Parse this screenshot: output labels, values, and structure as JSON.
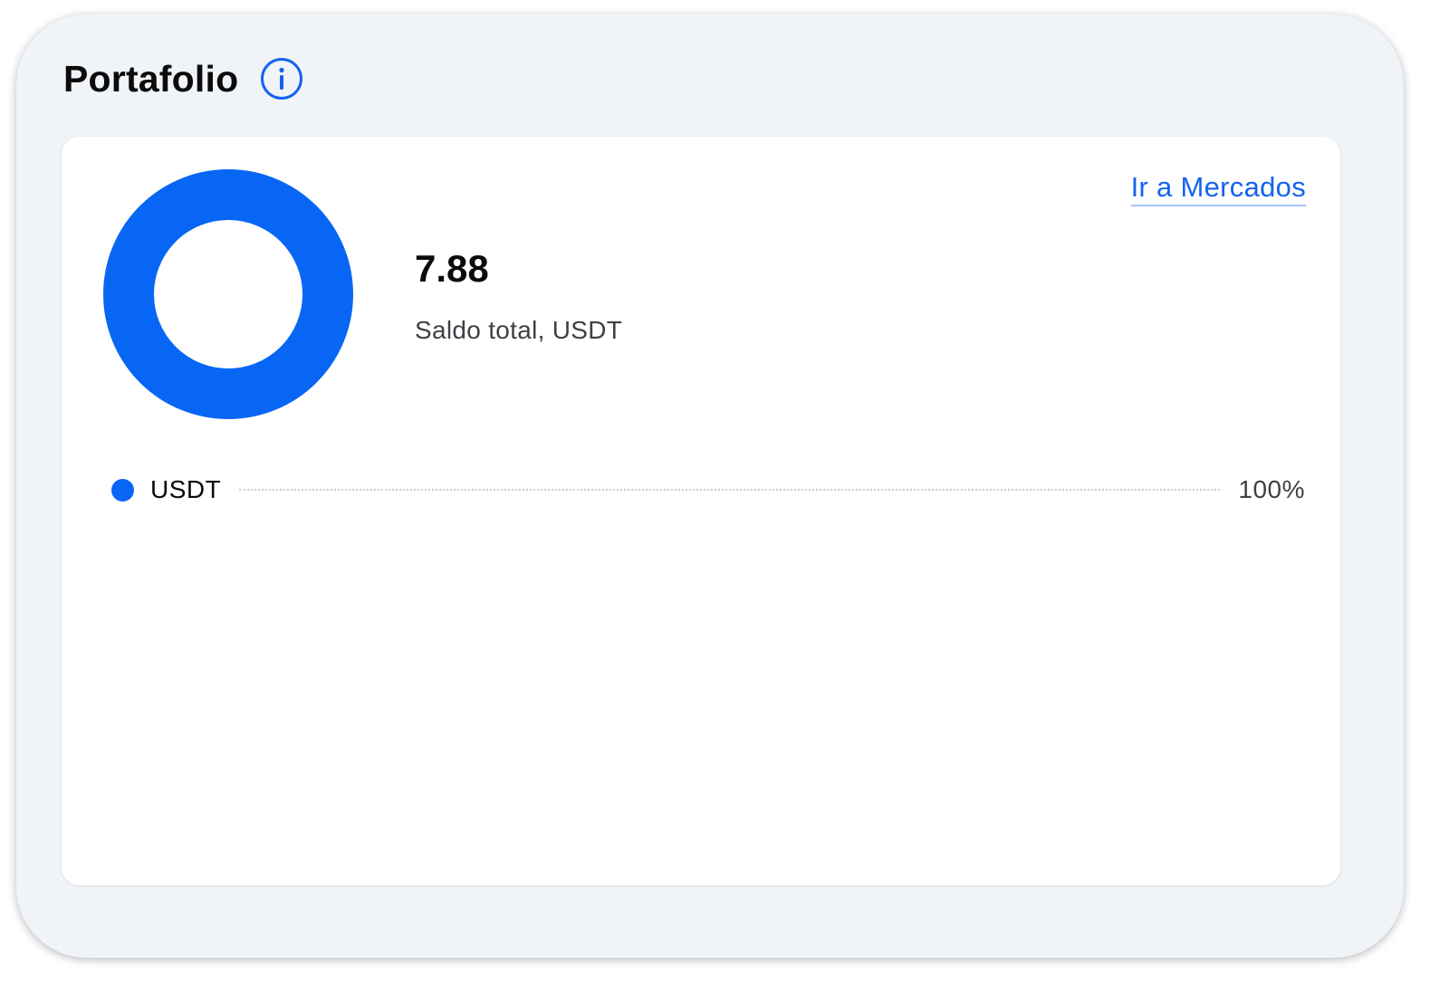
{
  "header": {
    "title": "Portafolio",
    "info_icon": "info-icon"
  },
  "portfolio": {
    "balance_value": "7.88",
    "balance_label": "Saldo total, USDT",
    "markets_link": "Ir a Mercados",
    "accent_color": "#0866f5",
    "link_color": "#1463ef"
  },
  "chart_data": {
    "type": "pie",
    "categories": [
      "USDT"
    ],
    "values": [
      100
    ],
    "colors": [
      "#0866f5"
    ],
    "legend_labels": [
      "100%"
    ]
  }
}
